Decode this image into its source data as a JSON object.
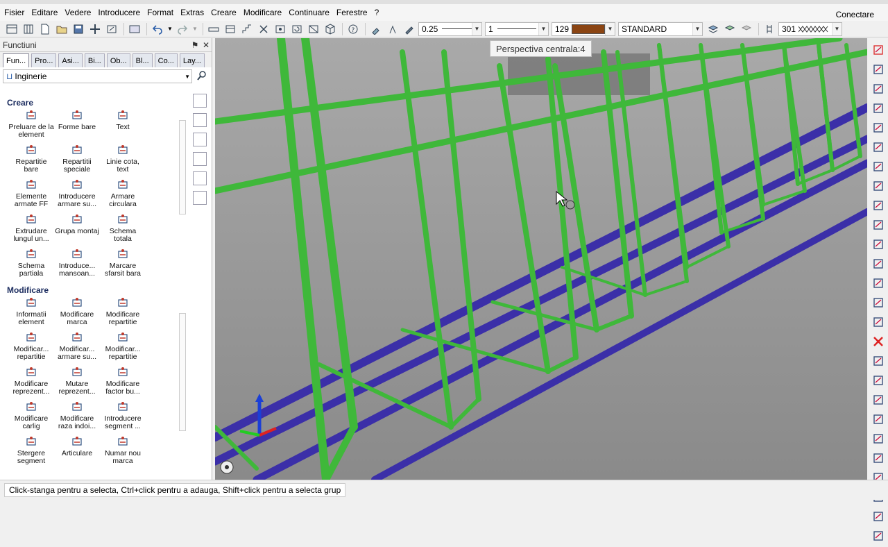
{
  "menu": [
    "Fisier",
    "Editare",
    "Vedere",
    "Introducere",
    "Format",
    "Extras",
    "Creare",
    "Modificare",
    "Continuare",
    "Ferestre",
    "?"
  ],
  "account": "Conectare",
  "toolbar": {
    "pen_thickness": "0.25",
    "line_type": "1",
    "color_index": "129",
    "layer": "STANDARD",
    "pattern_index": "301",
    "accent": "#8b4513"
  },
  "panel": {
    "title": "Functiuni",
    "pin": "⚑",
    "close": "✕",
    "tabs": [
      "Fun...",
      "Pro...",
      "Asi...",
      "Bi...",
      "Ob...",
      "Bl...",
      "Co...",
      "Lay..."
    ],
    "filter": "Inginerie",
    "sections": [
      {
        "title": "Creare",
        "items": [
          {
            "label": "Preluare de la element",
            "icon": "takeover-icon"
          },
          {
            "label": "Forme bare",
            "icon": "bar-shapes-icon"
          },
          {
            "label": "Text",
            "icon": "text-icon"
          },
          {
            "label": "Repartitie bare",
            "icon": "bar-placement-icon"
          },
          {
            "label": "Repartitii speciale",
            "icon": "special-placement-icon"
          },
          {
            "label": "Linie cota, text",
            "icon": "dimension-line-icon"
          },
          {
            "label": "Elemente armate FF",
            "icon": "reinforced-elements-icon"
          },
          {
            "label": "Introducere armare su...",
            "icon": "surface-reinforcement-icon"
          },
          {
            "label": "Armare circulara",
            "icon": "circular-reinforcement-icon"
          },
          {
            "label": "Extrudare lungul un...",
            "icon": "extrude-icon"
          },
          {
            "label": "Grupa montaj",
            "icon": "assembly-group-icon"
          },
          {
            "label": "Schema totala",
            "icon": "total-schedule-icon"
          },
          {
            "label": "Schema partiala",
            "icon": "partial-schedule-icon"
          },
          {
            "label": "Introduce... mansoan...",
            "icon": "coupler-icon"
          },
          {
            "label": "Marcare sfarsit bara",
            "icon": "bar-end-mark-icon"
          }
        ]
      },
      {
        "title": "Modificare",
        "items": [
          {
            "label": "Informatii element",
            "icon": "element-info-icon"
          },
          {
            "label": "Modificare marca",
            "icon": "modify-mark-icon"
          },
          {
            "label": "Modificare repartitie",
            "icon": "modify-placement-icon"
          },
          {
            "label": "Modificar... repartitie",
            "icon": "modify-placement2-icon"
          },
          {
            "label": "Modificar... armare su...",
            "icon": "modify-surface-icon"
          },
          {
            "label": "Modificar... repartitie",
            "icon": "modify-placement3-icon"
          },
          {
            "label": "Modificare reprezent...",
            "icon": "modify-representation-icon"
          },
          {
            "label": "Mutare reprezent...",
            "icon": "move-representation-icon"
          },
          {
            "label": "Modificare factor bu...",
            "icon": "modify-factor-icon"
          },
          {
            "label": "Modificare carlig",
            "icon": "modify-hook-icon"
          },
          {
            "label": "Modificare raza indoi...",
            "icon": "modify-bend-radius-icon"
          },
          {
            "label": "Introducere segment ...",
            "icon": "insert-segment-icon"
          },
          {
            "label": "Stergere segment",
            "icon": "delete-segment-icon"
          },
          {
            "label": "Articulare",
            "icon": "articulate-icon"
          },
          {
            "label": "Numar nou marca",
            "icon": "new-mark-number-icon"
          }
        ]
      }
    ]
  },
  "viewport": {
    "tooltip": "Perspectiva centrala:4",
    "stirrup_color": "#3fb83a",
    "bar_color": "#3b2fa8"
  },
  "status": "Click-stanga pentru a selecta, Ctrl+click pentru a adauga, Shift+click pentru a selecta grup"
}
